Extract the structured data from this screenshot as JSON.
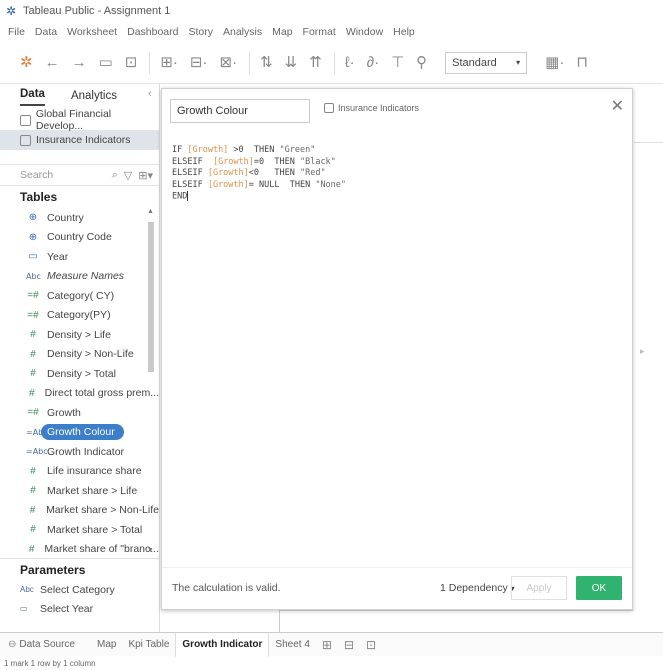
{
  "window": {
    "title": "Tableau Public - Assignment 1"
  },
  "menu": [
    "File",
    "Data",
    "Worksheet",
    "Dashboard",
    "Story",
    "Analysis",
    "Map",
    "Format",
    "Window",
    "Help"
  ],
  "toolbar": {
    "view_mode": "Standard"
  },
  "left_pane": {
    "tabs": [
      {
        "label": "Data",
        "active": true
      },
      {
        "label": "Analytics",
        "active": false
      }
    ],
    "datasources": [
      {
        "label": "Global Financial Develop...",
        "selected": false
      },
      {
        "label": "Insurance Indicators",
        "selected": true
      }
    ],
    "search_placeholder": "Search",
    "tables_title": "Tables",
    "fields": [
      {
        "label": "Country",
        "type": "geo"
      },
      {
        "label": "Country Code",
        "type": "geo"
      },
      {
        "label": "Year",
        "type": "date"
      },
      {
        "label": "Measure Names",
        "type": "abc",
        "italic": true
      },
      {
        "label": "Category( CY)",
        "type": "calc"
      },
      {
        "label": "Category(PY)",
        "type": "calc"
      },
      {
        "label": "Density > Life",
        "type": "num"
      },
      {
        "label": "Density > Non-Life",
        "type": "num"
      },
      {
        "label": "Density > Total",
        "type": "num"
      },
      {
        "label": "Direct total gross prem...",
        "type": "num"
      },
      {
        "label": "Growth",
        "type": "calc"
      },
      {
        "label": "Growth Colour",
        "type": "calcabc",
        "selected": true
      },
      {
        "label": "Growth Indicator",
        "type": "calcabc"
      },
      {
        "label": "Life insurance share",
        "type": "num"
      },
      {
        "label": "Market share > Life",
        "type": "num"
      },
      {
        "label": "Market share > Non-Life",
        "type": "num"
      },
      {
        "label": "Market share > Total",
        "type": "num"
      },
      {
        "label": "Market share of \"branc...",
        "type": "num"
      }
    ],
    "parameters_title": "Parameters",
    "parameters": [
      {
        "label": "Select Category",
        "type": "abc"
      },
      {
        "label": "Select Year",
        "type": "date"
      }
    ]
  },
  "calc_editor": {
    "name": "Growth Colour",
    "datasource": "Insurance Indicators",
    "formula": [
      [
        {
          "t": "kw",
          "v": "IF "
        },
        {
          "t": "fld",
          "v": "[Growth]"
        },
        {
          "t": "kw",
          "v": " >0  THEN "
        },
        {
          "t": "str",
          "v": "\"Green\""
        }
      ],
      [
        {
          "t": "kw",
          "v": "ELSEIF  "
        },
        {
          "t": "fld",
          "v": "[Growth]"
        },
        {
          "t": "kw",
          "v": "=0  THEN "
        },
        {
          "t": "str",
          "v": "\"Black\""
        }
      ],
      [
        {
          "t": "kw",
          "v": "ELSEIF "
        },
        {
          "t": "fld",
          "v": "[Growth]"
        },
        {
          "t": "kw",
          "v": "<0   THEN "
        },
        {
          "t": "str",
          "v": "\"Red\""
        }
      ],
      [
        {
          "t": "kw",
          "v": "ELSEIF "
        },
        {
          "t": "fld",
          "v": "[Growth]"
        },
        {
          "t": "kw",
          "v": "= NULL  THEN "
        },
        {
          "t": "str",
          "v": "\"None\""
        }
      ],
      [
        {
          "t": "kw",
          "v": "END"
        }
      ]
    ],
    "status": "The calculation is valid.",
    "dependency": "1 Dependency",
    "apply_label": "Apply",
    "ok_label": "OK"
  },
  "sheet_tabs": [
    {
      "label": "Data Source",
      "kind": "ds"
    },
    {
      "label": "Map"
    },
    {
      "label": "Kpi Table"
    },
    {
      "label": "Growth Indicator",
      "active": true
    },
    {
      "label": "Sheet 4"
    }
  ],
  "status_bar": "1 mark    1 row by 1 column",
  "colors": {
    "accent": "#3c7ec9",
    "ok": "#2fb36e",
    "field": "#e2924a"
  }
}
